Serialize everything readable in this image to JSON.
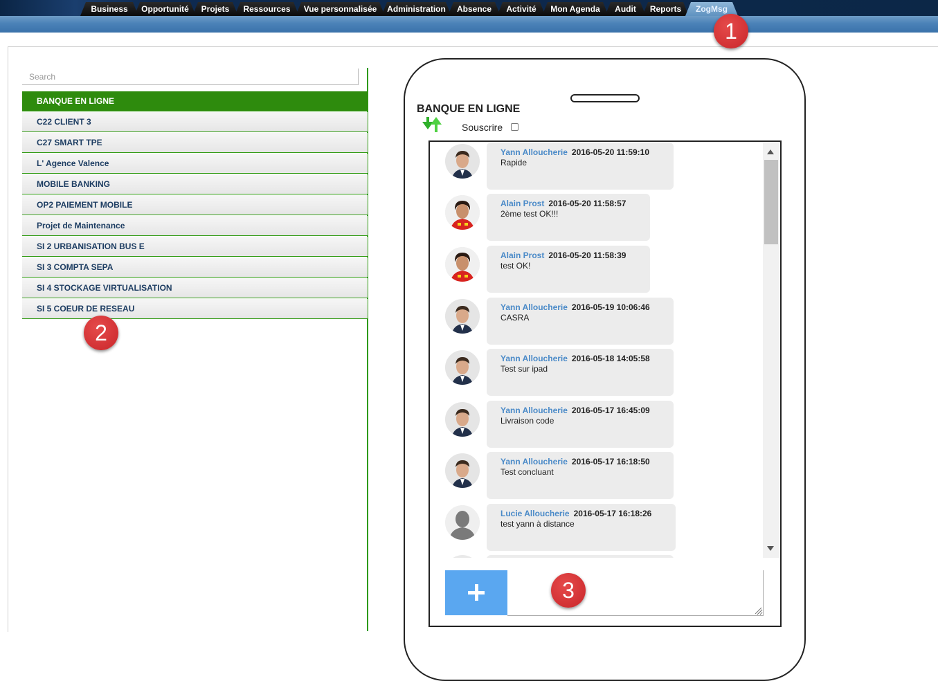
{
  "nav": {
    "tabs": [
      {
        "label": "Business",
        "active": false
      },
      {
        "label": "Opportunité",
        "active": false
      },
      {
        "label": "Projets",
        "active": false
      },
      {
        "label": "Ressources",
        "active": false
      },
      {
        "label": "Vue personnalisée",
        "active": false
      },
      {
        "label": "Administration",
        "active": false
      },
      {
        "label": "Absence",
        "active": false
      },
      {
        "label": "Activité",
        "active": false
      },
      {
        "label": "Mon Agenda",
        "active": false
      },
      {
        "label": "Audit",
        "active": false
      },
      {
        "label": "Reports",
        "active": false
      },
      {
        "label": "ZogMsg",
        "active": true
      }
    ]
  },
  "sidebar": {
    "search_placeholder": "Search",
    "projects": [
      {
        "label": "BANQUE EN LIGNE",
        "active": true
      },
      {
        "label": "C22 CLIENT 3",
        "active": false
      },
      {
        "label": "C27 SMART TPE",
        "active": false
      },
      {
        "label": "L' Agence Valence",
        "active": false
      },
      {
        "label": "MOBILE BANKING",
        "active": false
      },
      {
        "label": "OP2 PAIEMENT MOBILE",
        "active": false
      },
      {
        "label": "Projet de Maintenance",
        "active": false
      },
      {
        "label": "SI 2 URBANISATION BUS E",
        "active": false
      },
      {
        "label": "SI 3 COMPTA SEPA",
        "active": false
      },
      {
        "label": "SI 4 STOCKAGE VIRTUALISATION",
        "active": false
      },
      {
        "label": "SI 5 COEUR DE RESEAU",
        "active": false
      }
    ]
  },
  "channel": {
    "title": "BANQUE EN LIGNE",
    "subscribe_label": "Souscrire",
    "subscribed": false,
    "sort_icon": "sort-arrows-icon"
  },
  "messages": [
    {
      "author": "Yann Alloucherie",
      "timestamp": "2016-05-20 11:59:10",
      "text": "Rapide",
      "avatar": "yann-photo"
    },
    {
      "author": "Alain Prost",
      "timestamp": "2016-05-20 11:58:57",
      "text": "2ème test OK!!!",
      "avatar": "alain-photo"
    },
    {
      "author": "Alain Prost",
      "timestamp": "2016-05-20 11:58:39",
      "text": "test OK!",
      "avatar": "alain-photo"
    },
    {
      "author": "Yann Alloucherie",
      "timestamp": "2016-05-19 10:06:46",
      "text": "CASRA",
      "avatar": "yann-photo"
    },
    {
      "author": "Yann Alloucherie",
      "timestamp": "2016-05-18 14:05:58",
      "text": "Test sur ipad",
      "avatar": "yann-photo"
    },
    {
      "author": "Yann Alloucherie",
      "timestamp": "2016-05-17 16:45:09",
      "text": "Livraison code",
      "avatar": "yann-photo"
    },
    {
      "author": "Yann Alloucherie",
      "timestamp": "2016-05-17 16:18:50",
      "text": "Test concluant",
      "avatar": "yann-photo"
    },
    {
      "author": "Lucie Alloucherie",
      "timestamp": "2016-05-17 16:18:26",
      "text": "test yann à distance",
      "avatar": "default-silhouette"
    }
  ],
  "composer": {
    "add_icon": "plus-icon",
    "value": ""
  },
  "callouts": [
    "1",
    "2",
    "3"
  ],
  "colors": {
    "accent_green": "#2e8b0d",
    "link_blue": "#4a8ac8",
    "add_button": "#5aa7f0",
    "callout_red": "#d0302f"
  }
}
